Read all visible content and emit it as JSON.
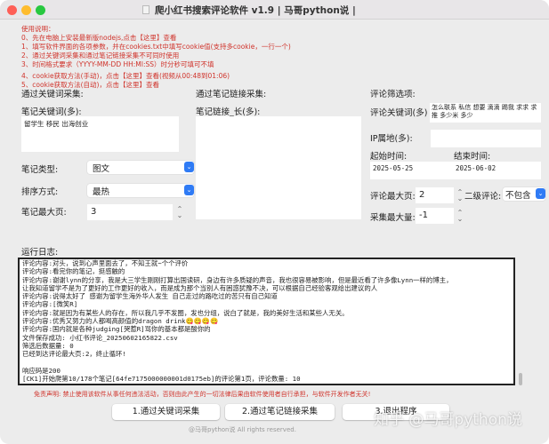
{
  "window": {
    "title": "爬小红书搜索评论软件 v1.9 | 马哥python说 |"
  },
  "instructions": [
    "使用说明：",
    "0、先在电脑上安装最新版nodejs,点击【这里】查看",
    "1、填写软件界面的各项参数，并在cookies.txt中填写cookie值(支持多cookie，一行一个)",
    "2、通过关键词采集和通过笔记链接采集不可同时使用",
    "3、时间格式要求（YYYY-MM-DD HH:MI:SS）时分秒可填可不填",
    "4、cookie获取方法(手动)，点击【这里】查看(视频从00:48到01:06)",
    "5、cookie获取方法(自动)，点击【这里】查看"
  ],
  "keyword_section": {
    "header": "通过关键词采集:",
    "keywords_label": "笔记关键词(多):",
    "keywords_value": "留学生 移民 出海创业",
    "type_label": "笔记类型:",
    "type_value": "图文",
    "sort_label": "排序方式:",
    "sort_value": "最热",
    "maxpage_label": "笔记最大页:",
    "maxpage_value": "3"
  },
  "link_section": {
    "header": "通过笔记链接采集:",
    "links_label": "笔记链接_长(多):",
    "links_value": ""
  },
  "filter_section": {
    "header": "评论筛选项:",
    "comment_kw_label": "评论关键词(多)",
    "comment_kw_value": "怎么联系 私信 想要 滴滴 踢我 求求 求推 多少米 多少",
    "ip_label": "IP属地(多):",
    "ip_value": "",
    "start_label": "起始时间:",
    "start_value": "2025-05-25",
    "end_label": "结束时间:",
    "end_value": "2025-06-02",
    "maxpage_label": "评论最大页:",
    "maxpage_value": "2",
    "level2_label": "二级评论:",
    "level2_value": "不包含",
    "maxcount_label": "采集最大量:",
    "maxcount_value": "-1"
  },
  "log": {
    "label": "运行日志:",
    "lines": [
      "评论内容:对头，说到心声里面去了，不知王就~个个评价",
      "评论内容:看完你的笔记，挺感触的",
      "评论内容:谢谢lynn的分享，我是大三学生刚刚打算出国读研，身边有许多质疑的声音，我也很容易被影响，但是最近看了许多像Lynn一样的博主，",
      "让我知道留学不是为了更好的工作更好的收入，而是成为那个当别人有困惑犹豫不决，可以根据自己经验客观给出建议的人",
      "评论内容:说得太好了 感谢为留学生海外华人发生 自己走过的路吃过的苦只有自己知道",
      "评论内容:[微笑R]",
      "评论内容:就是因为有某些人的存在，所以我几乎不发圈，发也分组，说白了就是，我的美好生活和某些人无关。",
      "评论内容:优秀又努力的人都喝高颜值的dragon drink😋😋😋😋",
      "评论内容:国内就是各种judging[哭惹R]骂你的基本都是酸你的",
      "文件保存成功: 小红书评论_20250602165822.csv",
      "筛选后数据量: 0",
      "已经到达评论最大页:2，终止循环!",
      "",
      "响应码是200",
      "[CK1]开始爬第10/178个笔记[64fe7175000000001d0175eb]的评论第1页，评论数量: 10"
    ]
  },
  "disclaimer": "免责声明: 禁止使用该软件从事任何违法活动，否则由此产生的一切法律后果由软件使用者自行承担，与软件开发作者无关!",
  "buttons": {
    "keyword": "1.通过关键词采集",
    "link": "2.通过笔记链接采集",
    "exit": "3.退出程序"
  },
  "copyright": "@马哥python说 All rights reserved.",
  "watermark": "知乎 @马哥python说",
  "colors": {
    "red": "#d0342c",
    "accent": "#2f7bf5"
  }
}
